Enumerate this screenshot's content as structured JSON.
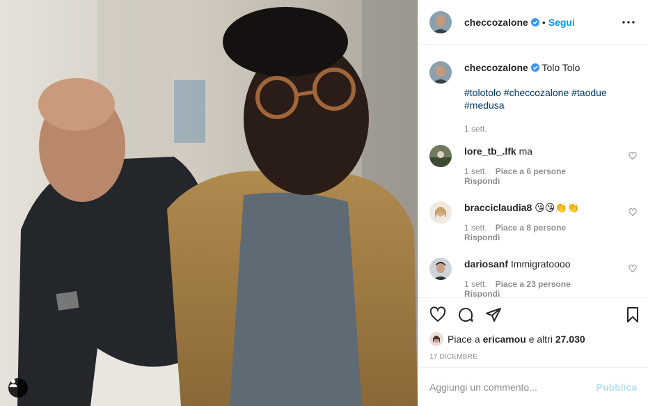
{
  "post": {
    "author": "checcozalone",
    "follow_label": "Segui",
    "dot": "•",
    "caption_text": "Tolo Tolo",
    "hashtags": [
      "#tolotolo",
      "#checcozalone",
      "#taodue",
      "#medusa"
    ],
    "caption_time": "1 sett.",
    "liked_by_prefix": "Piace a ",
    "liked_by_user": "ericamou",
    "liked_by_suffix": " e altri ",
    "likes_count": "27.030",
    "date": "17 DICEMBRE"
  },
  "comments": [
    {
      "user": "lore_tb_.lfk",
      "text": "ma",
      "time": "1 sett.",
      "likes": "Piace a 6 persone",
      "reply": "Rispondi"
    },
    {
      "user": "bracciclaudia8",
      "text": "😘😘👏👏",
      "time": "1 sett.",
      "likes": "Piace a 8 persone",
      "reply": "Rispondi"
    },
    {
      "user": "dariosanf",
      "text": "Immigratoooo",
      "time": "1 sett.",
      "likes": "Piace a 23 persone",
      "reply": "Rispondi"
    }
  ],
  "composer": {
    "placeholder": "Aggiungi un commento...",
    "publish_label": "Pubblica"
  },
  "icons": {
    "verified": "verified-badge-icon",
    "more": "more-options-icon",
    "like": "heart-icon",
    "comment": "comment-icon",
    "share": "paper-plane-icon",
    "save": "bookmark-icon",
    "user_tag": "user-tag-icon"
  },
  "colors": {
    "link": "#0095f6",
    "hashtag": "#00376b",
    "muted": "#8e8e8e",
    "publish_disabled": "#b2dffc"
  }
}
